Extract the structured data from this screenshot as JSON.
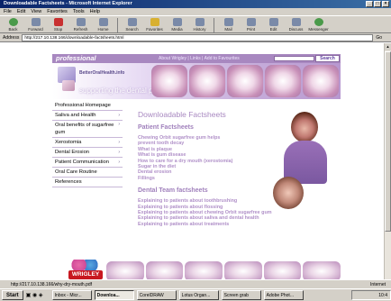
{
  "window": {
    "title": "Downloadable Factsheets - Microsoft Internet Explorer"
  },
  "menu": [
    "File",
    "Edit",
    "View",
    "Favorites",
    "Tools",
    "Help"
  ],
  "toolbar": {
    "buttons": [
      "Back",
      "Forward",
      "Stop",
      "Refresh",
      "Home",
      "Search",
      "Favorites",
      "Media",
      "History",
      "Mail",
      "Print",
      "Edit",
      "Discuss",
      "Messenger"
    ]
  },
  "address": {
    "label": "Address",
    "url": "http://217.10.138.166/downloadable-factsheets.html",
    "go_label": "Go"
  },
  "site": {
    "brand": "professional",
    "top_links": "About Wrigley | Links | Add to Favourites",
    "search_button": "Search",
    "logo_text": "BetterOralHealth.info",
    "tagline": "supporting the dental profession"
  },
  "sidebar": {
    "items": [
      {
        "label": "Professional Homepage",
        "arrow": ""
      },
      {
        "label": "Saliva and Health",
        "arrow": "›"
      },
      {
        "label": "Oral benefits of sugarfree gum",
        "arrow": "›"
      },
      {
        "label": "Xerostomia",
        "arrow": "›"
      },
      {
        "label": "Dental Erosion",
        "arrow": "›"
      },
      {
        "label": "Patient Communication",
        "arrow": "›"
      },
      {
        "label": "Oral Care Routine",
        "arrow": ""
      },
      {
        "label": "References",
        "arrow": ""
      }
    ]
  },
  "main": {
    "title": "Downloadable Factsheets",
    "patient_heading": "Patient Factsheets",
    "patient_links": [
      "Chewing Orbit sugarfree gum helps",
      "prevent tooth decay",
      "What is plaque",
      "What is gum disease",
      "How to care for a dry mouth (xerostomia)",
      "Sugar in the diet",
      "Dental erosion",
      "Fillings"
    ],
    "team_heading": "Dental Team factsheets",
    "team_links": [
      "Explaining to patients about toothbrushing",
      "Explaining to patients about flossing",
      "Explaining to patients about chewing Orbit sugarfree gum",
      "Explaining to patients about saliva and dental health",
      "Explaining to patients about treatments"
    ]
  },
  "footer": {
    "logo_text": "WRIGLEY"
  },
  "status": {
    "text": "http://217.10.138.166/why-dry-mouth.pdf",
    "zone": "Internet"
  },
  "taskbar": {
    "start": "Start",
    "tasks": [
      "Inbox - Micr...",
      "Downloa...",
      "CorelDRAW",
      "Lotus Organ...",
      "Screen grab",
      "Adobe Phot..."
    ],
    "clock": "10:4"
  }
}
